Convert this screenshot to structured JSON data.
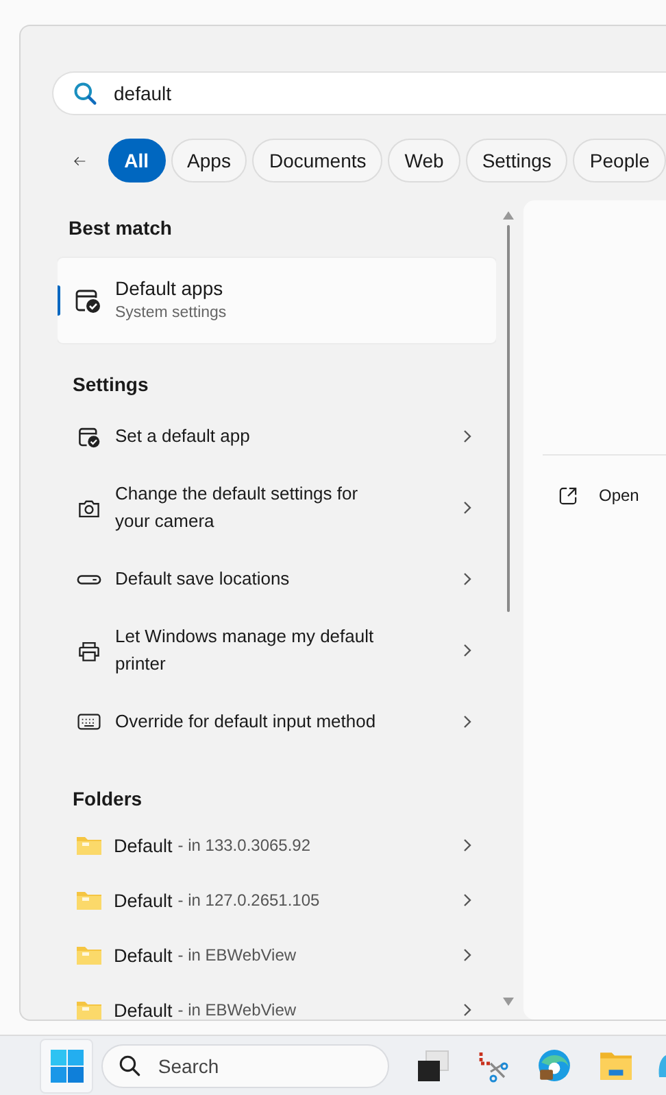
{
  "search": {
    "value": "default"
  },
  "filters": [
    {
      "label": "All",
      "selected": true
    },
    {
      "label": "Apps",
      "selected": false
    },
    {
      "label": "Documents",
      "selected": false
    },
    {
      "label": "Web",
      "selected": false
    },
    {
      "label": "Settings",
      "selected": false
    },
    {
      "label": "People",
      "selected": false
    }
  ],
  "best_match": {
    "heading": "Best match",
    "title": "Default apps",
    "subtitle": "System settings",
    "selected": true
  },
  "settings": {
    "heading": "Settings",
    "items": [
      {
        "kind": "default-app",
        "label": "Set a default app"
      },
      {
        "kind": "camera",
        "label": "Change the default settings for your camera"
      },
      {
        "kind": "drive",
        "label": "Default save locations"
      },
      {
        "kind": "printer",
        "label": "Let Windows manage my default printer"
      },
      {
        "kind": "keyboard",
        "label": "Override for default input method"
      }
    ]
  },
  "folders": {
    "heading": "Folders",
    "items": [
      {
        "name": "Default",
        "location": "- in 133.0.3065.92"
      },
      {
        "name": "Default",
        "location": "- in 127.0.2651.105"
      },
      {
        "name": "Default",
        "location": "- in EBWebView"
      },
      {
        "name": "Default",
        "location": "- in EBWebView"
      }
    ]
  },
  "preview": {
    "actions": [
      "Open"
    ]
  },
  "taskbar": {
    "search_placeholder": "Search"
  }
}
